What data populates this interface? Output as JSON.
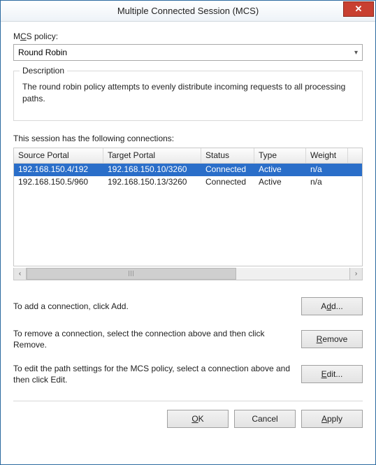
{
  "window": {
    "title": "Multiple Connected Session (MCS)",
    "close_glyph": "✕"
  },
  "policy": {
    "label_pre": "M",
    "label_under": "C",
    "label_post": "S policy:",
    "selected": "Round Robin"
  },
  "description": {
    "legend": "Description",
    "text": "The round robin policy attempts to evenly distribute incoming requests to all processing paths."
  },
  "connections": {
    "label": "This session has the following connections:",
    "headers": [
      "Source Portal",
      "Target Portal",
      "Status",
      "Type",
      "Weight"
    ],
    "rows": [
      {
        "selected": true,
        "cells": [
          "192.168.150.4/192",
          "192.168.150.10/3260",
          "Connected",
          "Active",
          "n/a"
        ]
      },
      {
        "selected": false,
        "cells": [
          "192.168.150.5/960",
          "192.168.150.13/3260",
          "Connected",
          "Active",
          "n/a"
        ]
      }
    ]
  },
  "actions": {
    "add": {
      "text": "To add a connection, click Add.",
      "btn_pre": "A",
      "btn_u": "d",
      "btn_post": "d..."
    },
    "remove": {
      "text": "To remove a connection, select the connection above and then click Remove.",
      "btn_pre": "",
      "btn_u": "R",
      "btn_post": "emove"
    },
    "edit": {
      "text": "To edit the path settings for the MCS policy, select a connection above and then click Edit.",
      "btn_pre": "",
      "btn_u": "E",
      "btn_post": "dit..."
    }
  },
  "footer": {
    "ok": {
      "pre": "",
      "u": "O",
      "post": "K"
    },
    "cancel": {
      "pre": "Cancel",
      "u": "",
      "post": ""
    },
    "apply": {
      "pre": "",
      "u": "A",
      "post": "pply"
    }
  }
}
